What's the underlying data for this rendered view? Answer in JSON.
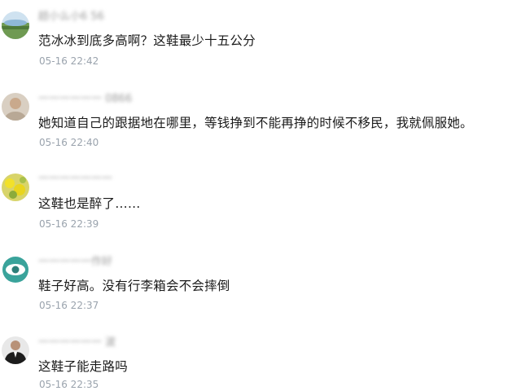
{
  "comments": [
    {
      "username": "趏小么小6 56",
      "avatar_icon": "landscape-avatar-icon",
      "text": "范冰冰到底多高啊？这鞋最少十五公分",
      "time": "05-16 22:42"
    },
    {
      "username": "一一一一一一 0866",
      "avatar_icon": "blurred-person-avatar-icon",
      "text": "她知道自己的跟据地在哪里，等钱挣到不能再挣的时候不移民，我就佩服她。",
      "time": "05-16 22:40"
    },
    {
      "username": "一一一一一一一",
      "avatar_icon": "yellow-flower-avatar-icon",
      "text": "这鞋也是醉了……",
      "time": "05-16 22:39"
    },
    {
      "username": "一一一一一作好",
      "avatar_icon": "teal-eye-avatar-icon",
      "text": "鞋子好高。没有行李箱会不会摔倒",
      "time": "05-16 22:37"
    },
    {
      "username": "一一一一一一 波",
      "avatar_icon": "suit-man-avatar-icon",
      "text": "这鞋子能走路吗",
      "time": "05-16 22:35"
    }
  ]
}
